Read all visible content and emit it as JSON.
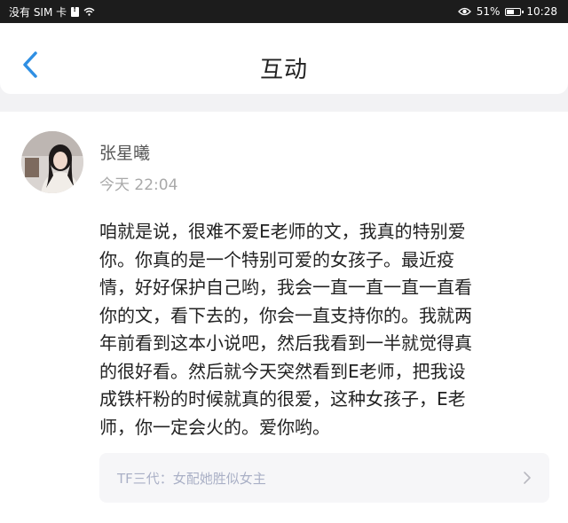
{
  "status_bar": {
    "carrier": "没有 SIM 卡",
    "battery": "51%",
    "time": "10:28"
  },
  "header": {
    "title": "互动"
  },
  "post": {
    "username": "张星曦",
    "timestamp": "今天 22:04",
    "lines": [
      "咱就是说，很难不爱E老师的文，我真的特别爱",
      "你。你真的是一个特别可爱的女孩子。最近疫",
      "情，好好保护自己哟，我会一直一直一直一直看",
      "你的文，看下去的，你会一直支持你的。我就两",
      "年前看到这本小说吧，然后我看到一半就觉得真",
      "的很好看。然后就今天突然看到E老师，把我设",
      "成铁杆粉的时候就真的很爱，这种女孩子，E老",
      "师，你一定会火的。爱你哟。"
    ],
    "link_text": "TF三代：女配她胜似女主"
  },
  "colors": {
    "accent": "#2f8fe3",
    "status_bar_bg": "#1c1c1c",
    "page_bg": "#f2f2f4",
    "link_text": "#aab0c6"
  }
}
